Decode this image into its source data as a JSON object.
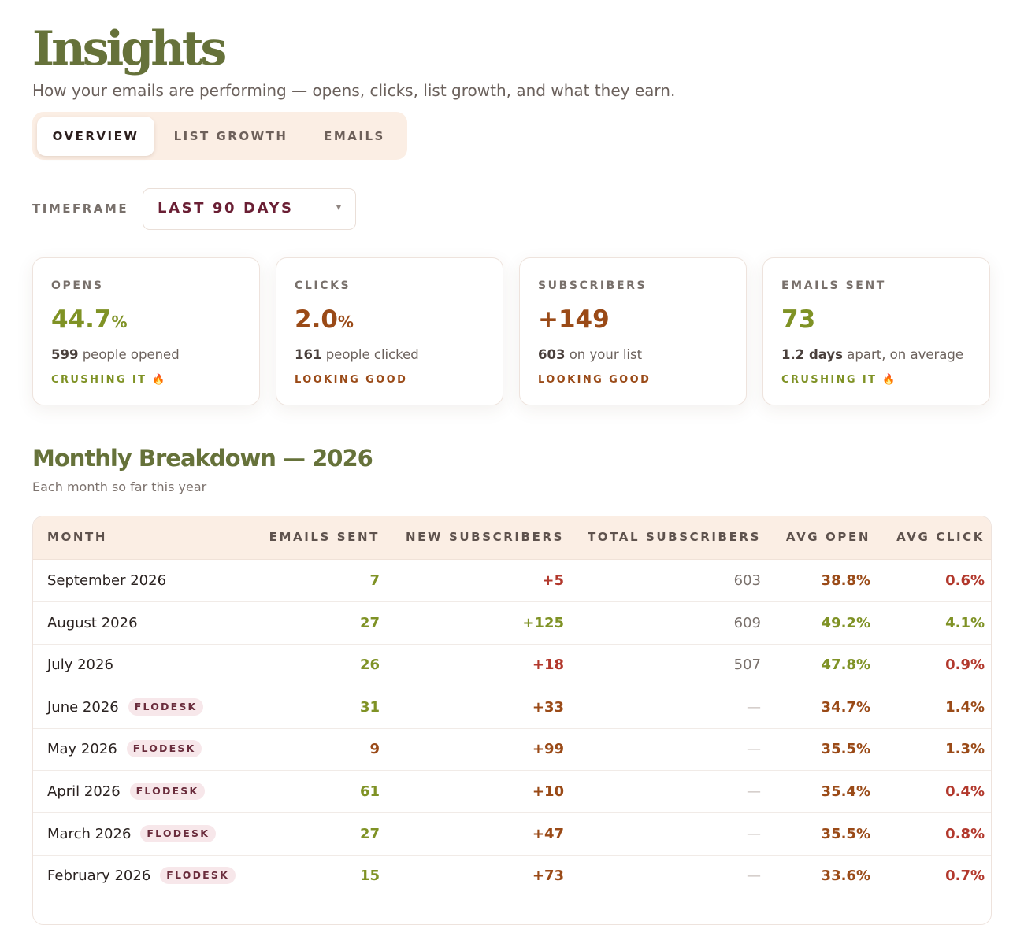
{
  "header": {
    "title": "Insights",
    "subtitle": "How your emails are performing — opens, clicks, list growth, and what they earn."
  },
  "tabs": [
    {
      "label": "OVERVIEW",
      "active": true
    },
    {
      "label": "LIST GROWTH",
      "active": false
    },
    {
      "label": "EMAILS",
      "active": false
    }
  ],
  "timeframe": {
    "label": "TIMEFRAME",
    "selected": "LAST 90 DAYS",
    "caret_icon": "caret-down-icon"
  },
  "stats": [
    {
      "label": "OPENS",
      "value": "44.7",
      "unit": "%",
      "detail_strong": "599",
      "detail_rest": " people opened",
      "status": "CRUSHING IT 🔥"
    },
    {
      "label": "CLICKS",
      "value": "2.0",
      "unit": "%",
      "detail_strong": "161",
      "detail_rest": " people clicked",
      "status": "LOOKING GOOD"
    },
    {
      "label": "SUBSCRIBERS",
      "value": "+149",
      "unit": "",
      "detail_strong": "603",
      "detail_rest": " on your list",
      "status": "LOOKING GOOD"
    },
    {
      "label": "EMAILS SENT",
      "value": "73",
      "unit": "",
      "detail_strong": "1.2 days",
      "detail_rest": " apart, on average",
      "status": "CRUSHING IT 🔥"
    }
  ],
  "breakdown": {
    "title": "Monthly Breakdown — 2026",
    "subtitle": "Each month so far this year",
    "columns": [
      "MONTH",
      "EMAILS SENT",
      "NEW SUBSCRIBERS",
      "TOTAL SUBSCRIBERS",
      "AVG OPEN",
      "AVG CLICK"
    ],
    "rows": [
      {
        "month": "September 2026",
        "badge": "",
        "emails_sent": "7",
        "new_subscribers": "+5",
        "total_subscribers": "603",
        "avg_open": "38.8%",
        "avg_click": "0.6%"
      },
      {
        "month": "August 2026",
        "badge": "",
        "emails_sent": "27",
        "new_subscribers": "+125",
        "total_subscribers": "609",
        "avg_open": "49.2%",
        "avg_click": "4.1%"
      },
      {
        "month": "July 2026",
        "badge": "",
        "emails_sent": "26",
        "new_subscribers": "+18",
        "total_subscribers": "507",
        "avg_open": "47.8%",
        "avg_click": "0.9%"
      },
      {
        "month": "June 2026",
        "badge": "FLODESK",
        "emails_sent": "31",
        "new_subscribers": "+33",
        "total_subscribers": "—",
        "avg_open": "34.7%",
        "avg_click": "1.4%"
      },
      {
        "month": "May 2026",
        "badge": "FLODESK",
        "emails_sent": "9",
        "new_subscribers": "+99",
        "total_subscribers": "—",
        "avg_open": "35.5%",
        "avg_click": "1.3%"
      },
      {
        "month": "April 2026",
        "badge": "FLODESK",
        "emails_sent": "61",
        "new_subscribers": "+10",
        "total_subscribers": "—",
        "avg_open": "35.4%",
        "avg_click": "0.4%"
      },
      {
        "month": "March 2026",
        "badge": "FLODESK",
        "emails_sent": "27",
        "new_subscribers": "+47",
        "total_subscribers": "—",
        "avg_open": "35.5%",
        "avg_click": "0.8%"
      },
      {
        "month": "February 2026",
        "badge": "FLODESK",
        "emails_sent": "15",
        "new_subscribers": "+73",
        "total_subscribers": "—",
        "avg_open": "33.6%",
        "avg_click": "0.7%"
      }
    ]
  },
  "colors": {
    "olive": "#7f9225",
    "dark_olive": "#66723a",
    "rust": "#9a4a17",
    "red": "#b2382c",
    "maroon": "#6a1f34",
    "tab_bg": "#fbeee4",
    "badge_bg": "#f7e7ea"
  }
}
